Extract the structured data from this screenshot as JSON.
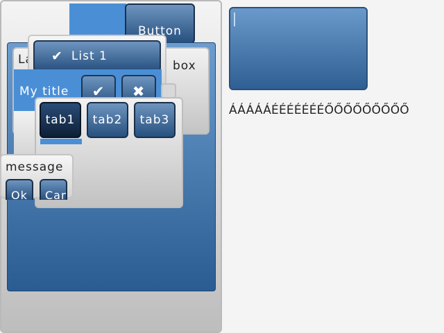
{
  "top_button": {
    "label": "Button"
  },
  "card": {
    "text_left": "La",
    "text_right": "box"
  },
  "list": {
    "item_label": "List 1"
  },
  "dialog": {
    "title": "My title"
  },
  "tabs": [
    {
      "label": "tab1",
      "selected": true
    },
    {
      "label": "tab2",
      "selected": false
    },
    {
      "label": "tab3",
      "selected": false
    }
  ],
  "message_box": {
    "text": "message",
    "ok_label": "Ok",
    "cancel_label": "Cancel"
  },
  "accent_text": "ÁÁÁÁÁÉÉÉÉÉÉÉŐŐŐŐŐŐŐŐŐ",
  "colors": {
    "accent": "#4a8fd6",
    "button_dark": "#1a2f4a",
    "panel_blue": "#2a5c92"
  }
}
